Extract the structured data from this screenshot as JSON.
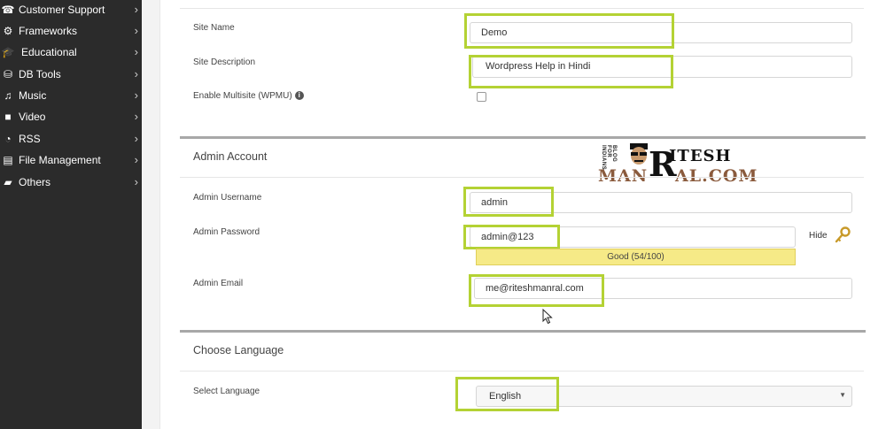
{
  "sidebar": {
    "items": [
      {
        "label": "Customer Support",
        "icon": "headset-icon",
        "glyph": "☎"
      },
      {
        "label": "Frameworks",
        "icon": "cogs-icon",
        "glyph": "⚙"
      },
      {
        "label": "Educational",
        "icon": "graduation-cap-icon",
        "glyph": "🎓"
      },
      {
        "label": "DB Tools",
        "icon": "database-icon",
        "glyph": "⛁"
      },
      {
        "label": "Music",
        "icon": "music-icon",
        "glyph": "♫"
      },
      {
        "label": "Video",
        "icon": "video-camera-icon",
        "glyph": "■"
      },
      {
        "label": "RSS",
        "icon": "rss-icon",
        "glyph": "◔"
      },
      {
        "label": "File Management",
        "icon": "file-icon",
        "glyph": "▤"
      },
      {
        "label": "Others",
        "icon": "folder-open-icon",
        "glyph": "▰"
      }
    ],
    "chevron": "›"
  },
  "site": {
    "name_label": "Site Name",
    "name_value": "Demo",
    "description_label": "Site Description",
    "description_value": "Wordpress Help in Hindi",
    "multisite_label": "Enable Multisite (WPMU)",
    "multisite_checked": false,
    "info_glyph": "i"
  },
  "admin": {
    "section_title": "Admin Account",
    "username_label": "Admin Username",
    "username_value": "admin",
    "password_label": "Admin Password",
    "password_value": "admin@123",
    "strength_text": "Good (54/100)",
    "hide_label": "Hide",
    "email_label": "Admin Email",
    "email_value": "me@riteshmanral.com"
  },
  "language": {
    "section_title": "Choose Language",
    "select_label": "Select Language",
    "selected_value": "English",
    "arrow": "▼"
  },
  "logo": {
    "tagline": "BLOG FOR INDIANS",
    "big_letter": "R",
    "top_text": "ITESH",
    "bottom_left": "MAN",
    "bottom_right": "AL.COM"
  },
  "colors": {
    "sidebar_bg": "#2b2b2b",
    "highlight": "#b4d234",
    "strength_bg": "#f6ea87"
  }
}
